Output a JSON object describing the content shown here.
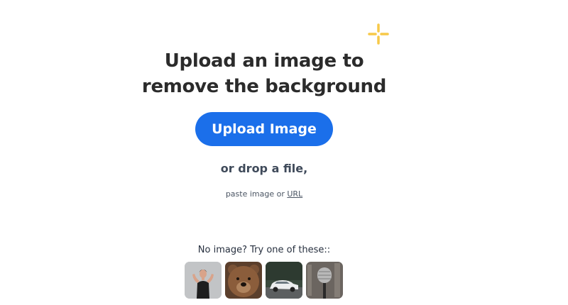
{
  "headline": {
    "line1": "Upload an image to",
    "line2": "remove the background"
  },
  "upload": {
    "button_label": "Upload Image"
  },
  "drop": {
    "text": "or drop a file,"
  },
  "paste": {
    "prefix": "paste image or ",
    "url_link": "URL"
  },
  "samples": {
    "label": "No image? Try one of these::",
    "items": [
      {
        "icon": "woman-photo-icon"
      },
      {
        "icon": "bear-photo-icon"
      },
      {
        "icon": "car-photo-icon"
      },
      {
        "icon": "microphone-photo-icon"
      }
    ]
  },
  "colors": {
    "accent": "#1b6fea",
    "sparkle": "#f7c948",
    "heading": "#2b2b2b"
  }
}
